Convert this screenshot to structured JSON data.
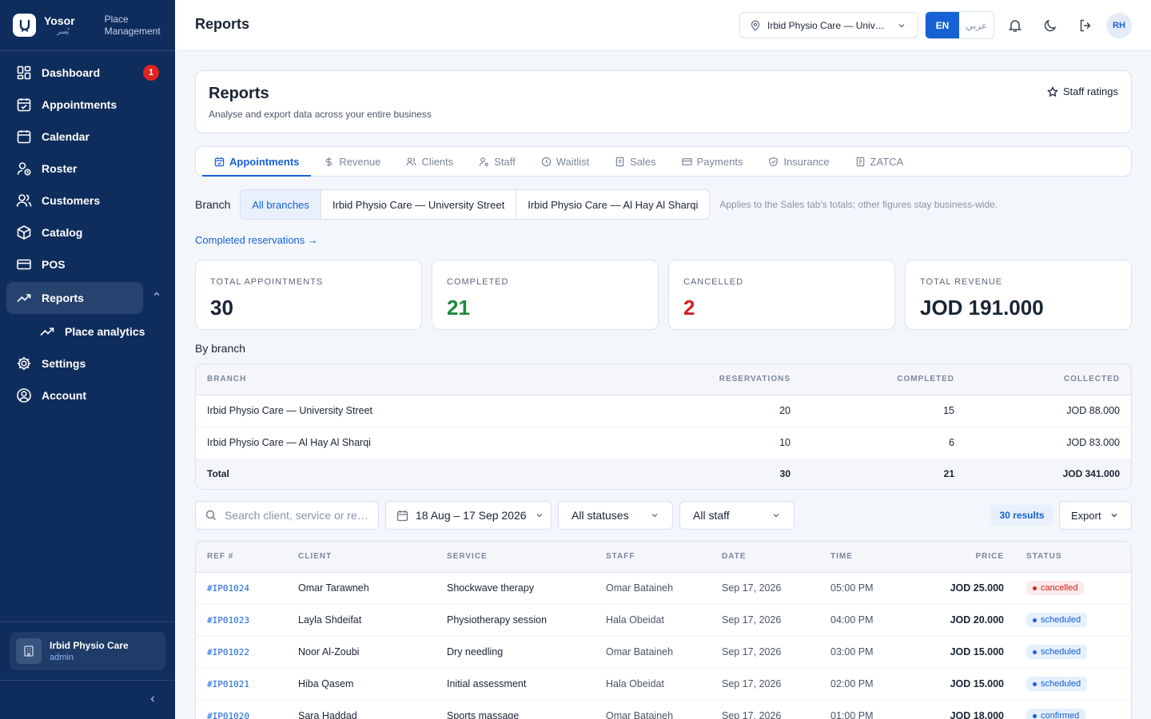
{
  "brand": {
    "name": "Yosor",
    "arabic": "يُسر",
    "subtitle_line1": "Place",
    "subtitle_line2": "Management"
  },
  "nav": [
    {
      "label": "Dashboard",
      "icon": "dashboard-icon",
      "badge": "1"
    },
    {
      "label": "Appointments",
      "icon": "calendar-check-icon"
    },
    {
      "label": "Calendar",
      "icon": "calendar-icon"
    },
    {
      "label": "Roster",
      "icon": "user-clock-icon"
    },
    {
      "label": "Customers",
      "icon": "users-icon"
    },
    {
      "label": "Catalog",
      "icon": "box-icon"
    },
    {
      "label": "POS",
      "icon": "card-icon"
    },
    {
      "label": "Reports",
      "icon": "trending-up-icon"
    },
    {
      "label": "Place analytics",
      "icon": "trending-up-icon"
    },
    {
      "label": "Settings",
      "icon": "gear-icon"
    },
    {
      "label": "Account",
      "icon": "user-circle-icon"
    }
  ],
  "org": {
    "name": "Irbid Physio Care",
    "role": "admin"
  },
  "topbar": {
    "title": "Reports",
    "branch": "Irbid Physio Care — University Street",
    "lang_en": "EN",
    "lang_ar": "عربي",
    "avatar": "RH"
  },
  "header": {
    "title": "Reports",
    "subtitle": "Analyse and export data across your entire business",
    "staff_ratings": "Staff ratings"
  },
  "tabs": [
    "Appointments",
    "Revenue",
    "Clients",
    "Staff",
    "Waitlist",
    "Sales",
    "Payments",
    "Insurance",
    "ZATCA"
  ],
  "branch_filter": {
    "label": "Branch",
    "options": [
      "All branches",
      "Irbid Physio Care — University Street",
      "Irbid Physio Care — Al Hay Al Sharqi"
    ],
    "note": "Applies to the Sales tab's totals; other figures stay business-wide."
  },
  "link": "Completed reservations →",
  "stats": [
    {
      "label": "TOTAL APPOINTMENTS",
      "value": "30",
      "color": "#1a2433"
    },
    {
      "label": "COMPLETED",
      "value": "21",
      "color": "#1e8a3c"
    },
    {
      "label": "CANCELLED",
      "value": "2",
      "color": "#d42020"
    },
    {
      "label": "TOTAL REVENUE",
      "value": "JOD 191.000",
      "color": "#1a2433"
    }
  ],
  "by_branch": {
    "title": "By branch",
    "headers": [
      "BRANCH",
      "RESERVATIONS",
      "COMPLETED",
      "COLLECTED"
    ],
    "rows": [
      [
        "Irbid Physio Care — University Street",
        "20",
        "15",
        "JOD 88.000"
      ],
      [
        "Irbid Physio Care — Al Hay Al Sharqi",
        "10",
        "6",
        "JOD 83.000"
      ]
    ],
    "total": [
      "Total",
      "30",
      "21",
      "JOD 341.000"
    ]
  },
  "filters": {
    "search_placeholder": "Search client, service or ref...",
    "date": "18 Aug – 17 Sep 2026",
    "status": "All statuses",
    "staff": "All staff",
    "results": "30 results",
    "export": "Export"
  },
  "appointments": {
    "headers": [
      "REF #",
      "CLIENT",
      "SERVICE",
      "STAFF",
      "DATE",
      "TIME",
      "PRICE",
      "STATUS"
    ],
    "rows": [
      [
        "#IP01024",
        "Omar Tarawneh",
        "Shockwave therapy",
        "Omar Bataineh",
        "Sep 17, 2026",
        "05:00 PM",
        "JOD 25.000",
        "cancelled"
      ],
      [
        "#IP01023",
        "Layla Shdeifat",
        "Physiotherapy session",
        "Hala Obeidat",
        "Sep 17, 2026",
        "04:00 PM",
        "JOD 20.000",
        "scheduled"
      ],
      [
        "#IP01022",
        "Noor Al-Zoubi",
        "Dry needling",
        "Omar Bataineh",
        "Sep 17, 2026",
        "03:00 PM",
        "JOD 15.000",
        "scheduled"
      ],
      [
        "#IP01021",
        "Hiba Qasem",
        "Initial assessment",
        "Hala Obeidat",
        "Sep 17, 2026",
        "02:00 PM",
        "JOD 15.000",
        "scheduled"
      ],
      [
        "#IP01020",
        "Sara Haddad",
        "Sports massage",
        "Omar Bataineh",
        "Sep 17, 2026",
        "01:00 PM",
        "JOD 18.000",
        "confirmed"
      ]
    ]
  }
}
